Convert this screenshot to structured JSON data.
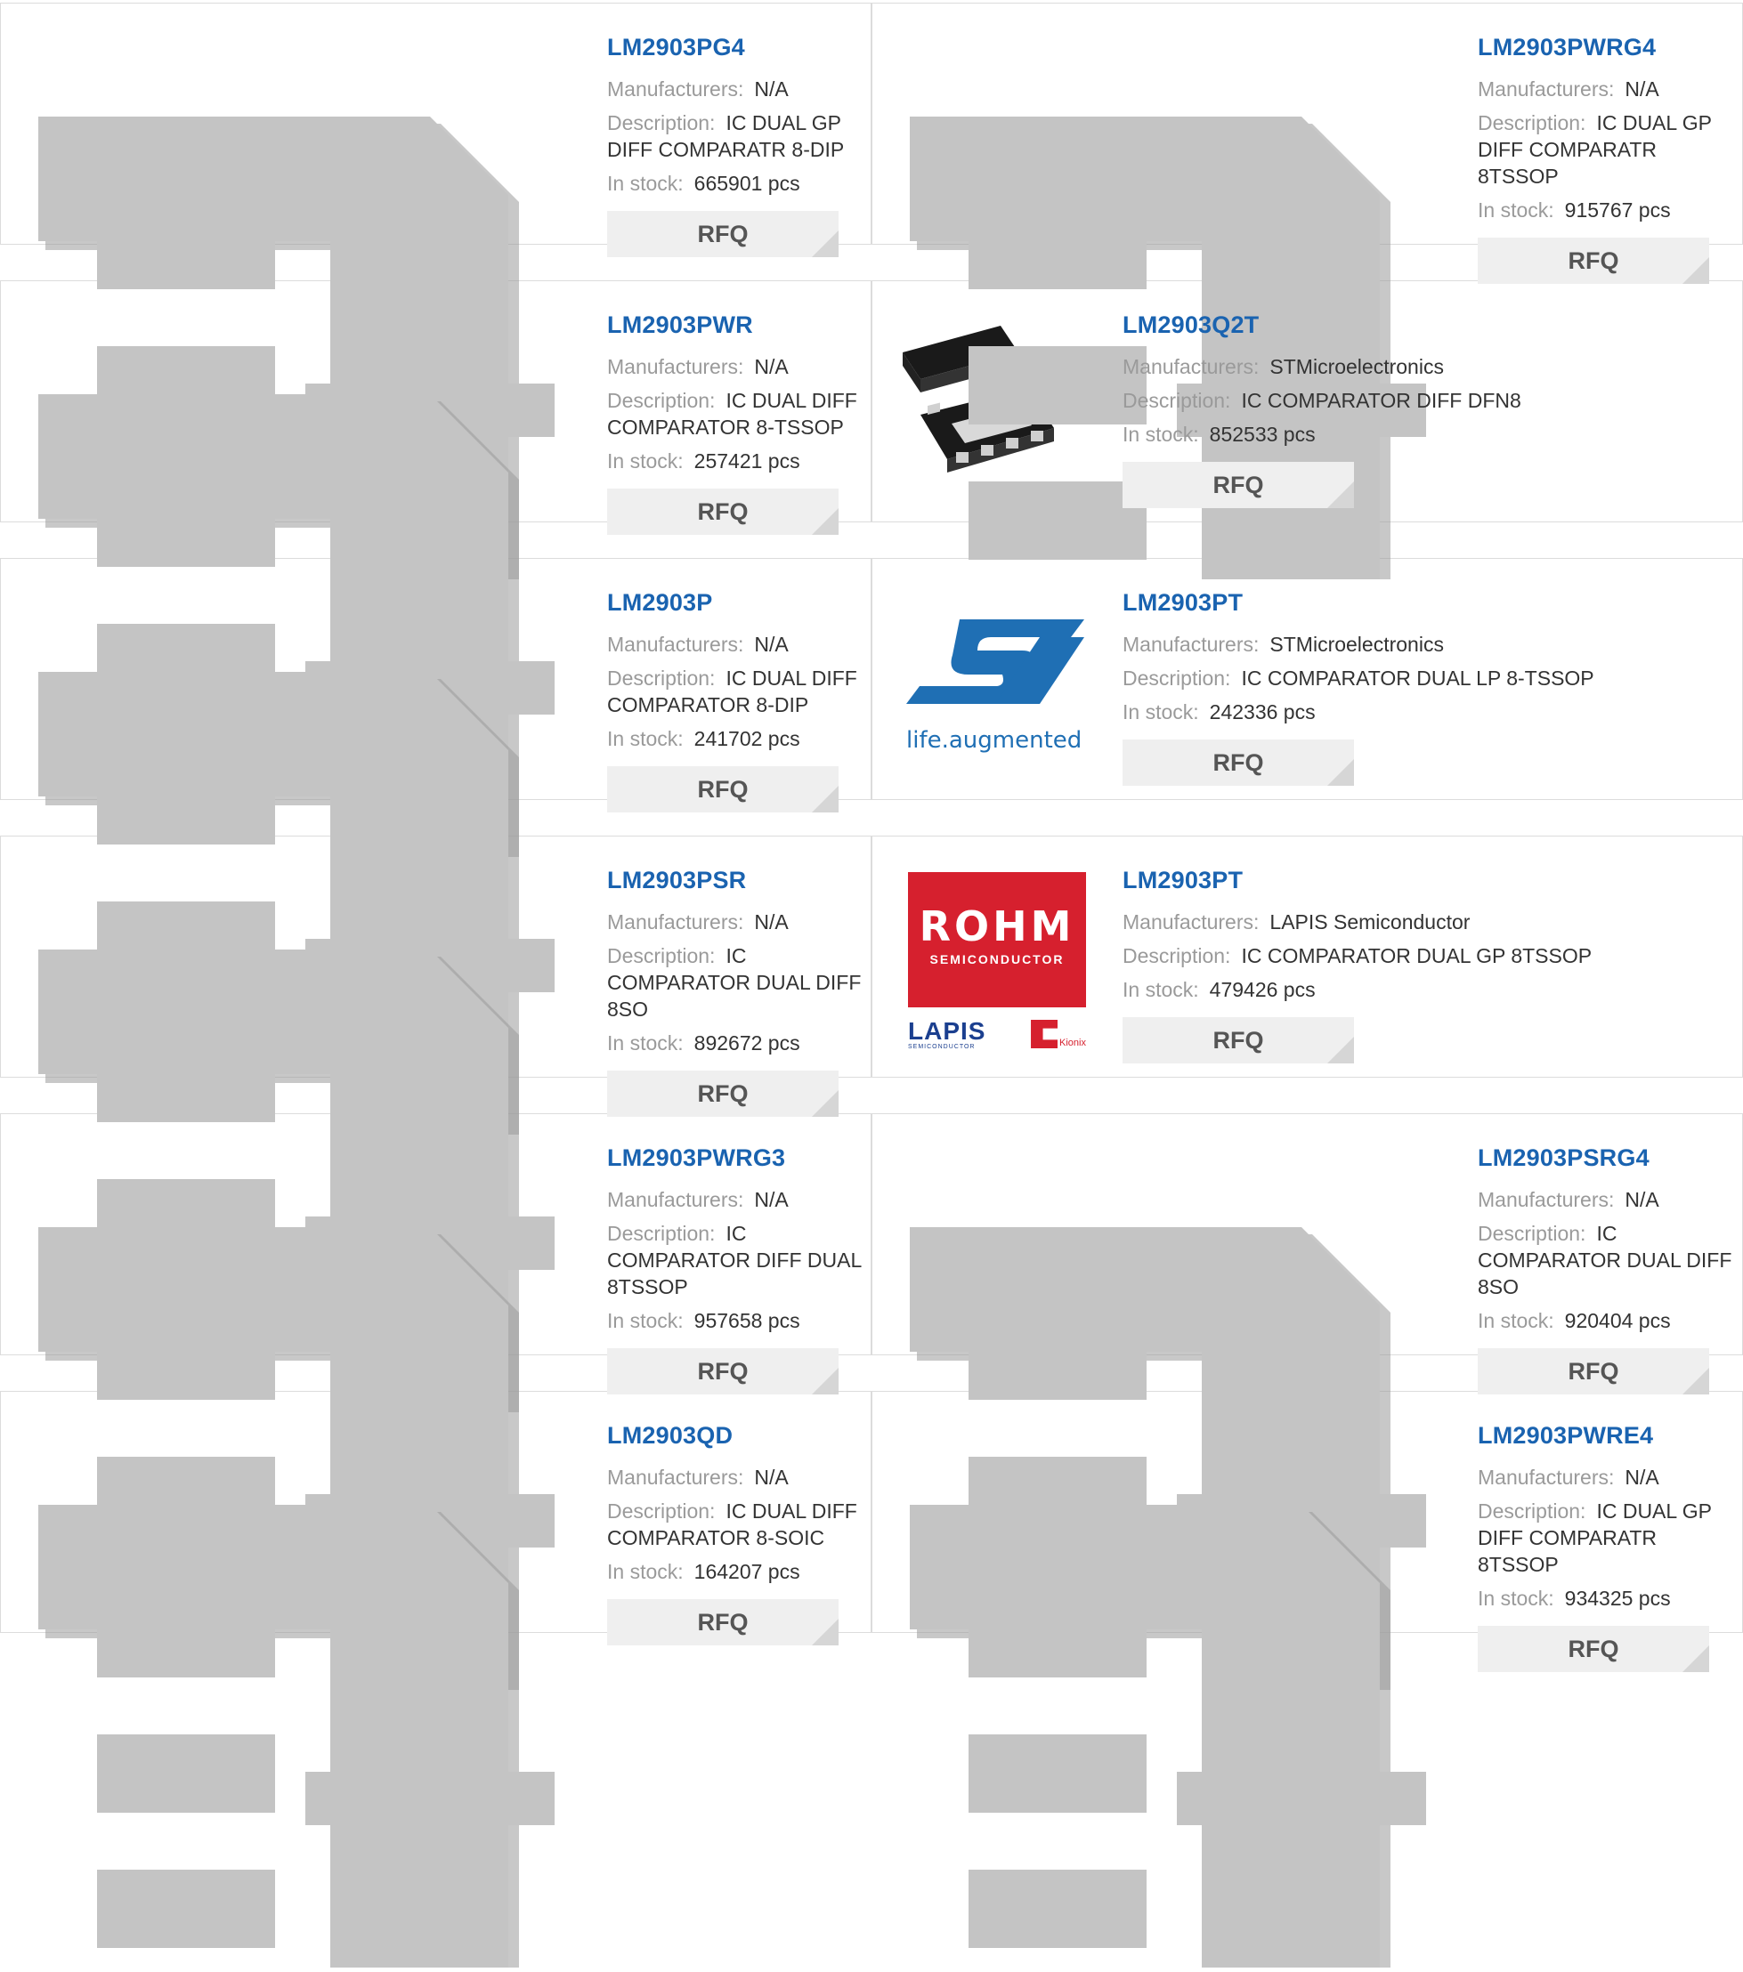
{
  "labels": {
    "manufacturers": "Manufacturers:",
    "description": "Description:",
    "in_stock": "In stock:",
    "rfq": "RFQ"
  },
  "products": [
    {
      "pn": "LM2903PG4",
      "mfr": "N/A",
      "desc": "IC DUAL GP DIFF COMPARATR 8-DIP",
      "stock": "665901 pcs",
      "image": "placeholder-chip"
    },
    {
      "pn": "LM2903PWRG4",
      "mfr": "N/A",
      "desc": "IC DUAL GP DIFF COMPARATR 8TSSOP",
      "stock": "915767 pcs",
      "image": "placeholder-chip"
    },
    {
      "pn": "LM2903PWR",
      "mfr": "N/A",
      "desc": "IC DUAL DIFF COMPARATOR 8-TSSOP",
      "stock": "257421 pcs",
      "image": "placeholder-chip"
    },
    {
      "pn": "LM2903Q2T",
      "mfr": "STMicroelectronics",
      "desc": "IC COMPARATOR DIFF DFN8",
      "stock": "852533 pcs",
      "image": "dfn8-package"
    },
    {
      "pn": "LM2903P",
      "mfr": "N/A",
      "desc": "IC DUAL DIFF COMPARATOR 8-DIP",
      "stock": "241702 pcs",
      "image": "placeholder-chip"
    },
    {
      "pn": "LM2903PT",
      "mfr": "STMicroelectronics",
      "desc": "IC COMPARATOR DUAL LP 8-TSSOP",
      "stock": "242336 pcs",
      "image": "st-logo"
    },
    {
      "pn": "LM2903PSR",
      "mfr": "N/A",
      "desc": "IC COMPARATOR DUAL DIFF 8SO",
      "stock": "892672 pcs",
      "image": "placeholder-chip"
    },
    {
      "pn": "LM2903PT",
      "mfr": "LAPIS Semiconductor",
      "desc": "IC COMPARATOR DUAL GP 8TSSOP",
      "stock": "479426 pcs",
      "image": "rohm-lapis-logo"
    },
    {
      "pn": "LM2903PWRG3",
      "mfr": "N/A",
      "desc": "IC COMPARATOR DIFF DUAL 8TSSOP",
      "stock": "957658 pcs",
      "image": "placeholder-chip"
    },
    {
      "pn": "LM2903PSRG4",
      "mfr": "N/A",
      "desc": "IC COMPARATOR DUAL DIFF 8SO",
      "stock": "920404 pcs",
      "image": "placeholder-chip"
    },
    {
      "pn": "LM2903QD",
      "mfr": "N/A",
      "desc": "IC DUAL DIFF COMPARATOR 8-SOIC",
      "stock": "164207 pcs",
      "image": "placeholder-chip"
    },
    {
      "pn": "LM2903PWRE4",
      "mfr": "N/A",
      "desc": "IC DUAL GP DIFF COMPARATR 8TSSOP",
      "stock": "934325 pcs",
      "image": "placeholder-chip"
    }
  ],
  "logos": {
    "st_tagline": "life.augmented",
    "rohm_name": "ROHM",
    "rohm_sub": "SEMICONDUCTOR",
    "lapis_name": "LAPIS",
    "lapis_sub": "SEMICONDUCTOR",
    "kionix_name": "Kionix"
  },
  "colors": {
    "part_number": "#1a63b0",
    "label": "#9a9a9a",
    "rfq_bg": "#efefef",
    "placeholder": "#c4c4c4",
    "rohm_red": "#d6202e",
    "st_blue": "#1f6fb4"
  }
}
